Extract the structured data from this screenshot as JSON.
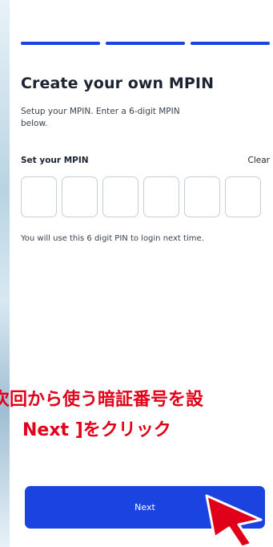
{
  "page": {
    "title": "Create your own MPIN",
    "subtitle": "Setup your MPIN. Enter a 6-digit MPIN below.",
    "mpin_label": "Set your MPIN",
    "clear_label": "Clear",
    "pin_digits": [
      "",
      "",
      "",
      "",
      "",
      ""
    ],
    "helper_text": "You will use this 6 digit PIN to login next time.",
    "next_label": "Next"
  },
  "progress": {
    "steps_total": 3,
    "steps_completed": 3
  },
  "annotation": {
    "line1": "次回から使う暗証番号を設",
    "line2": "Next ]をクリック"
  },
  "colors": {
    "accent": "#1a43e0",
    "annotation": "#e0001a",
    "text": "#1b2430"
  },
  "icons": {
    "pointer": "red-arrow-cursor-icon"
  }
}
